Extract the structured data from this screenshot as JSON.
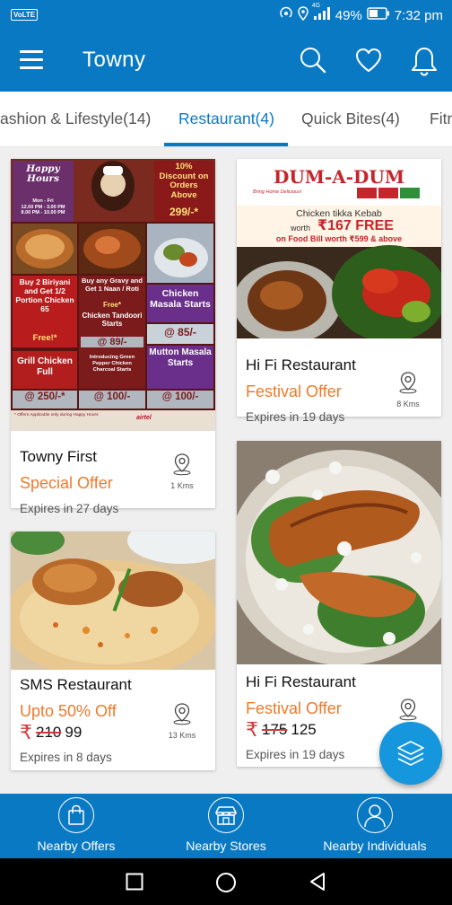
{
  "status_bar": {
    "volte": "VoLTE",
    "network": "4G",
    "battery": "49%",
    "time": "7:32 pm",
    "icons": [
      "hotspot-icon",
      "location-icon",
      "signal-icon",
      "battery-icon"
    ]
  },
  "app_bar": {
    "title": "Towny",
    "icons": [
      "menu-icon",
      "search-icon",
      "heart-icon",
      "bell-icon"
    ]
  },
  "tabs": [
    {
      "label": "ashion & Lifestyle(14)",
      "active": false
    },
    {
      "label": "Restaurant(4)",
      "active": true
    },
    {
      "label": "Quick Bites(4)",
      "active": false
    },
    {
      "label": "Fitn",
      "active": false
    }
  ],
  "cards": [
    {
      "title": "Towny First",
      "offer": "Special Offer",
      "expiry": "Expires in 27 days",
      "distance": "1 Kms",
      "image": {
        "happy_hours": "Happy Hours",
        "timings": "Mon - Fri\n12.00 PM - 3.00 PM\n8.00 PM - 10.00 PM",
        "discount": "10% Discount on Orders Above",
        "discount_min": "299/-*",
        "biriyani_offer": "Buy 2 Biriyani and Get 1/2 Portion Chicken 65",
        "free": "Free!*",
        "gravy_offer": "Buy any Gravy and Get 1 Naan / Roti",
        "gravy_free": "Free*",
        "chicken_masala": "Chicken Masala Starts",
        "tandoori": "Chicken Tandoori Starts",
        "price_89": "@ 89/-",
        "price_85": "@ 85/-",
        "grill": "Grill Chicken Full",
        "charcoal": "Introducing Green Pepper Chicken Charcoal Starts",
        "mutton": "Mutton Masala Starts",
        "price_250": "@ 250/-*",
        "price_100a": "@ 100/-",
        "price_100b": "@ 100/-",
        "footnote": "* Offers Applicable only during Happy Hours",
        "airtel": "airtel"
      }
    },
    {
      "title": "Hi Fi Restaurant",
      "offer": "Festival Offer",
      "expiry": "Expires in 19 days",
      "distance": "8 Kms",
      "image": {
        "brand": "DUM-A-DUM",
        "tagline": "Bring Home Delicious!",
        "kebab": "Chicken tikka Kebab",
        "worth": "worth",
        "amount": "₹167 FREE",
        "condition": "on Food Bill worth ₹599 & above"
      }
    },
    {
      "title": "SMS Restaurant",
      "offer": "Upto 50% Off",
      "old_price": "210",
      "new_price": "99",
      "expiry": "Expires in 8 days",
      "distance": "13 Kms"
    },
    {
      "title": "Hi Fi Restaurant",
      "offer": "Festival Offer",
      "old_price": "175",
      "new_price": "125",
      "expiry": "Expires in 19 days"
    }
  ],
  "currency_symbol": "₹",
  "fab": {
    "icon": "layers-icon"
  },
  "bottom_nav": [
    {
      "label": "Nearby Offers",
      "icon": "shopping-bag-icon"
    },
    {
      "label": "Nearby Stores",
      "icon": "store-icon"
    },
    {
      "label": "Nearby Individuals",
      "icon": "person-icon"
    }
  ],
  "system_nav": [
    "recents-icon",
    "home-icon",
    "back-icon"
  ],
  "colors": {
    "primary": "#0a79c4",
    "accent_orange": "#ee7a2a",
    "price_red": "#d23b3b",
    "fab": "#1696dc"
  }
}
